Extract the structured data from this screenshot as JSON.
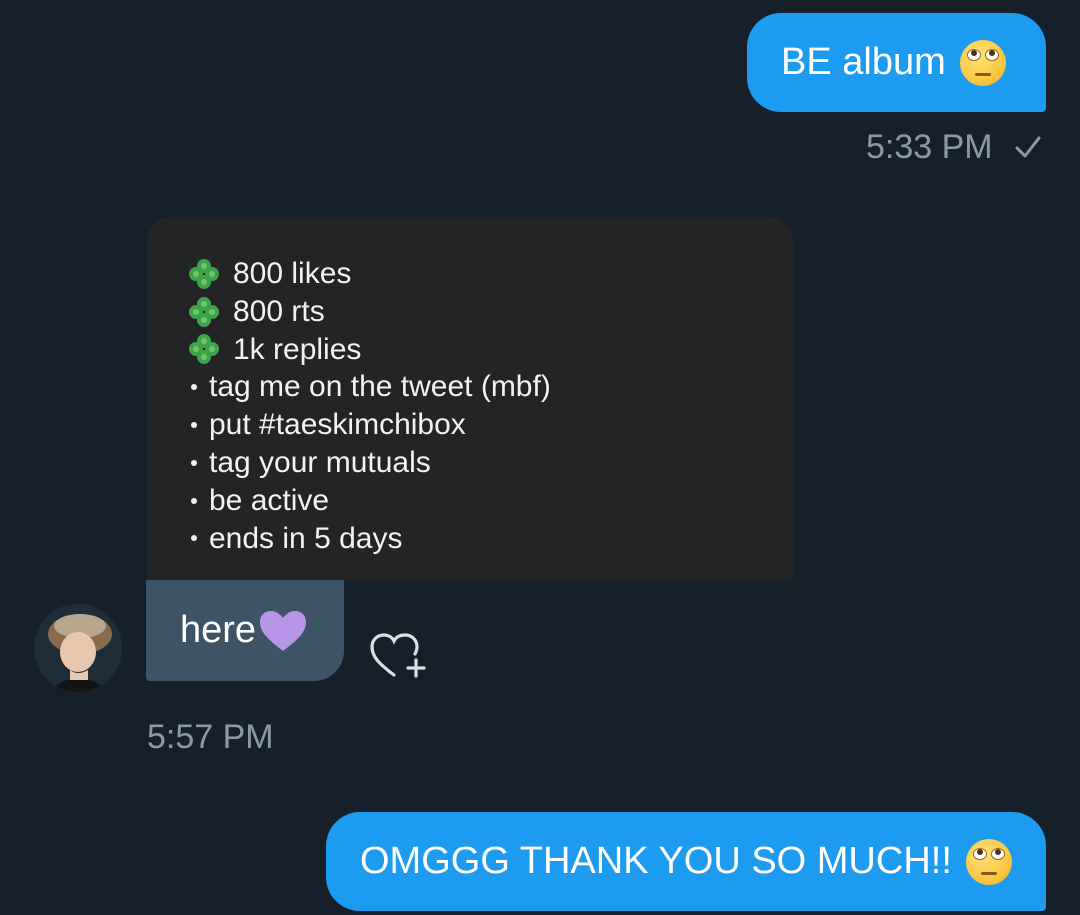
{
  "messages": {
    "out_1": {
      "text": "BE album",
      "time": "5:33 PM",
      "status_icon": "check-icon"
    },
    "card": {
      "lines": [
        {
          "icon": "clover-icon",
          "text": "800 likes"
        },
        {
          "icon": "clover-icon",
          "text": "800 rts"
        },
        {
          "icon": "clover-icon",
          "text": "1k replies"
        },
        {
          "icon": "bullet",
          "text": "tag me on the tweet (mbf)"
        },
        {
          "icon": "bullet",
          "text": "put #taeskimchibox"
        },
        {
          "icon": "bullet",
          "text": "tag your mutuals"
        },
        {
          "icon": "bullet",
          "text": "be active"
        },
        {
          "icon": "bullet",
          "text": "ends in 5 days"
        }
      ]
    },
    "in_1": {
      "text": "here",
      "emoji": "purple-heart-icon",
      "time": "5:57 PM"
    },
    "out_2": {
      "text": "OMGGG THANK YOU SO MUCH!!"
    }
  },
  "colors": {
    "background": "#15202b",
    "outgoing_bubble": "#1d9bf0",
    "incoming_bubble": "#3d5466",
    "timestamp": "#8b98a5"
  }
}
